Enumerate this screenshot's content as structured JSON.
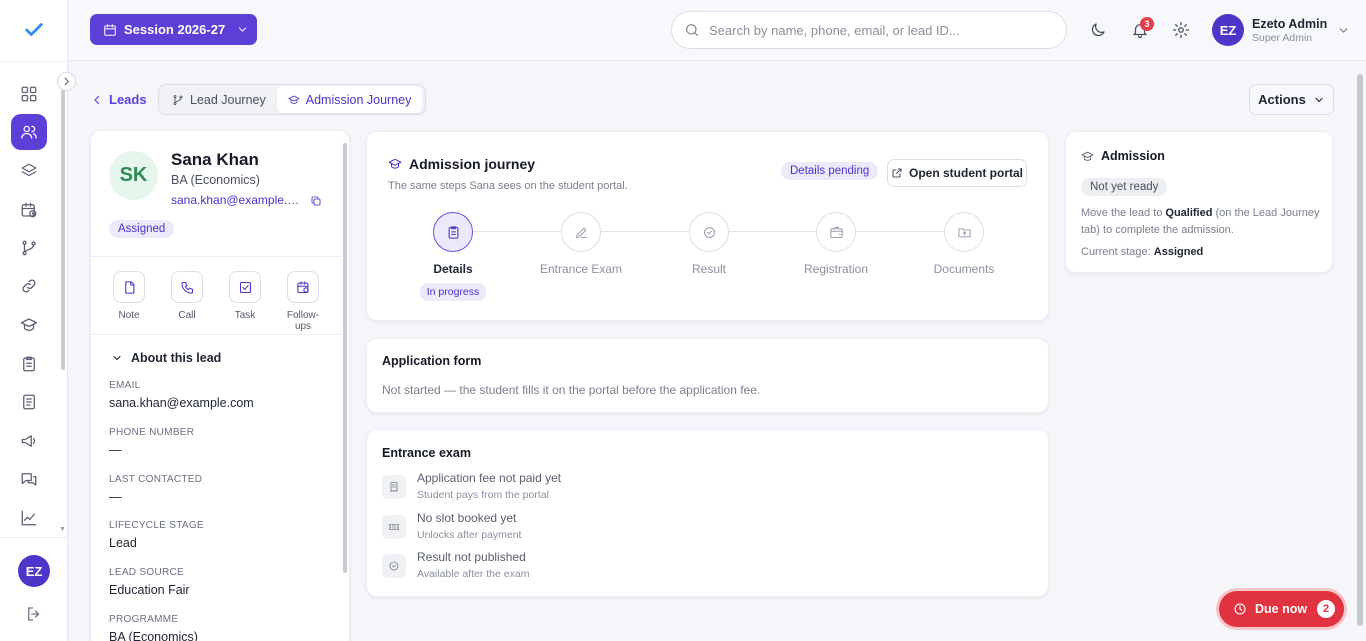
{
  "header": {
    "session_label": "Session 2026-27",
    "search_placeholder": "Search by name, phone, email, or lead ID...",
    "notification_count": "3",
    "user": {
      "initials": "EZ",
      "name": "Ezeto Admin",
      "role": "Super Admin"
    }
  },
  "sidebar": {
    "items": [
      {
        "icon": "dashboard-grid-icon"
      },
      {
        "icon": "users-icon",
        "active": true
      },
      {
        "icon": "layers-icon"
      },
      {
        "icon": "calendar-clock-icon"
      },
      {
        "icon": "git-branch-icon"
      },
      {
        "icon": "link-icon"
      },
      {
        "icon": "graduation-cap-icon"
      },
      {
        "icon": "clipboard-icon"
      },
      {
        "icon": "document-icon"
      },
      {
        "icon": "megaphone-icon"
      },
      {
        "icon": "chat-icon"
      },
      {
        "icon": "chart-icon"
      }
    ],
    "avatar_initials": "EZ"
  },
  "breadcrumb": {
    "back_label": "Leads",
    "tabs": [
      {
        "label": "Lead Journey",
        "active": false
      },
      {
        "label": "Admission Journey",
        "active": true
      }
    ],
    "actions_label": "Actions"
  },
  "lead": {
    "initials": "SK",
    "name": "Sana Khan",
    "programme": "BA (Economics)",
    "email_short": "sana.khan@example.com",
    "status": "Assigned",
    "quick_actions": [
      "Note",
      "Call",
      "Task",
      "Follow-ups"
    ],
    "about_heading": "About this lead",
    "fields": [
      {
        "label": "EMAIL",
        "value": "sana.khan@example.com"
      },
      {
        "label": "PHONE NUMBER",
        "value": "—"
      },
      {
        "label": "LAST CONTACTED",
        "value": "—"
      },
      {
        "label": "LIFECYCLE STAGE",
        "value": "Lead"
      },
      {
        "label": "LEAD SOURCE",
        "value": "Education Fair"
      },
      {
        "label": "PROGRAMME",
        "value": "BA (Economics)"
      }
    ]
  },
  "journey": {
    "title": "Admission journey",
    "subtitle": "The same steps Sana sees on the student portal.",
    "status_badge": "Details pending",
    "portal_button": "Open student portal",
    "steps": [
      {
        "label": "Details",
        "status": "In progress",
        "active": true
      },
      {
        "label": "Entrance Exam"
      },
      {
        "label": "Result"
      },
      {
        "label": "Registration"
      },
      {
        "label": "Documents"
      }
    ]
  },
  "application_form": {
    "title": "Application form",
    "text": "Not started — the student fills it on the portal before the application fee."
  },
  "entrance_exam": {
    "title": "Entrance exam",
    "items": [
      {
        "title": "Application fee not paid yet",
        "subtitle": "Student pays from the portal"
      },
      {
        "title": "No slot booked yet",
        "subtitle": "Unlocks after payment"
      },
      {
        "title": "Result not published",
        "subtitle": "Available after the exam"
      }
    ]
  },
  "admission": {
    "title": "Admission",
    "badge": "Not yet ready",
    "text_before": "Move the lead to ",
    "text_bold": "Qualified",
    "text_after": " (on the Lead Journey tab) to complete the admission.",
    "stage_label": "Current stage: ",
    "stage_value": "Assigned"
  },
  "due_now": {
    "label": "Due now",
    "count": "2"
  },
  "colors": {
    "accent": "#5b3fd6",
    "danger": "#e0323f"
  }
}
